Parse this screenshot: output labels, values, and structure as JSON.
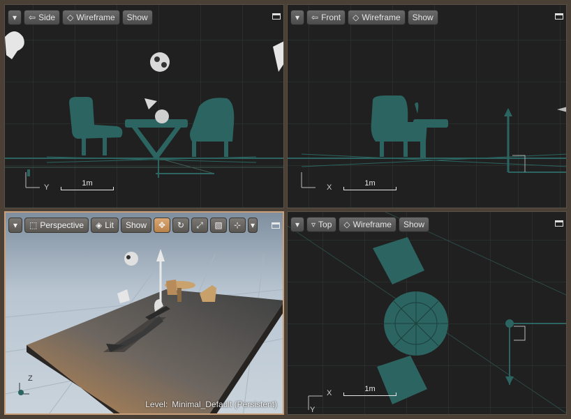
{
  "viewports": {
    "side": {
      "view_label": "Side",
      "mode_label": "Wireframe",
      "show_label": "Show",
      "axis_h": "Y",
      "scale_label": "1m"
    },
    "front": {
      "view_label": "Front",
      "mode_label": "Wireframe",
      "show_label": "Show",
      "axis_h": "X",
      "scale_label": "1m"
    },
    "perspective": {
      "view_label": "Perspective",
      "mode_label": "Lit",
      "show_label": "Show",
      "axis_v": "Z",
      "level_prefix": "Level:",
      "level_name": "Minimal_Default (Persistent)"
    },
    "top": {
      "view_label": "Top",
      "mode_label": "Wireframe",
      "show_label": "Show",
      "axis_h": "X",
      "axis_v": "Y",
      "scale_label": "1m"
    }
  },
  "colors": {
    "viewport_bg": "#202020",
    "grid_major": "#2f4a44",
    "mesh_teal": "#2b6460",
    "active_border": "#c9a07a",
    "frame": "#4a4036"
  },
  "icons": {
    "menu": "chevron-down-icon",
    "maximize": "maximize-icon",
    "translate": "translate-icon",
    "rotate": "rotate-icon",
    "scale": "scale-icon",
    "surface": "surface-snapping-icon",
    "grid_snap": "grid-snap-icon"
  }
}
